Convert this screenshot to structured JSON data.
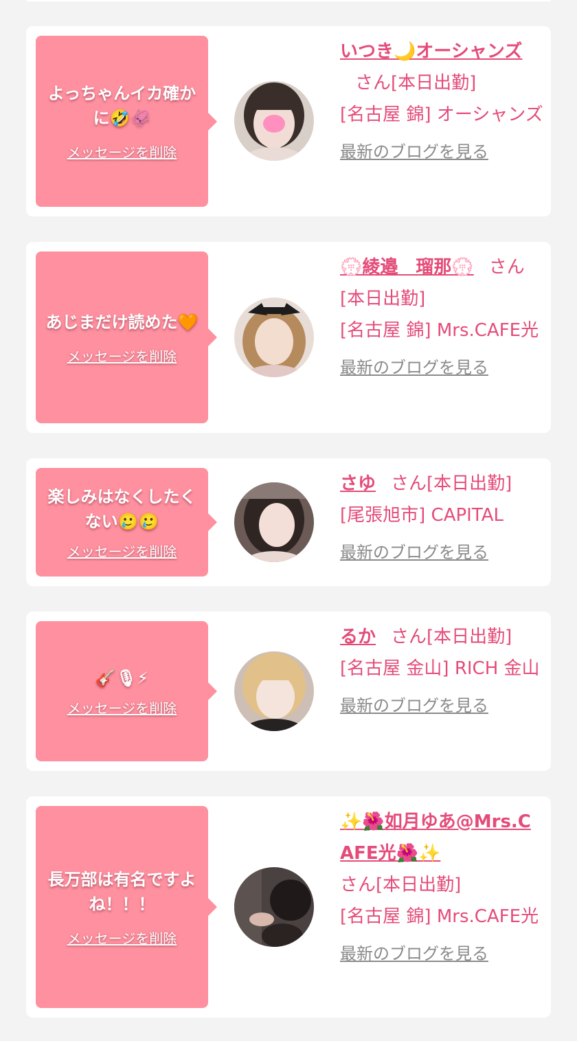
{
  "cards": [
    {
      "message": "よっちゃんイカ確かに🤣🦑",
      "delete_label": "メッセージを削除",
      "name": "いつき🌙オーシャンズ",
      "san_label": "さん[本日出勤]",
      "shop": "[名古屋 錦] オーシャンズ",
      "blog_label": "最新のブログを見る"
    },
    {
      "message": "あじまだけ読めた🧡",
      "delete_label": "メッセージを削除",
      "name": "💮綾邉　瑠那💮",
      "san_label": "さん[本日出勤]",
      "shop": "[名古屋 錦] Mrs.CAFE光",
      "blog_label": "最新のブログを見る"
    },
    {
      "message": "楽しみはなくしたくない🥲🥲",
      "delete_label": "メッセージを削除",
      "name": "さゆ",
      "san_label": "さん[本日出勤]",
      "shop": "[尾張旭市] CAPITAL",
      "blog_label": "最新のブログを見る"
    },
    {
      "message": "🎸🎙⚡",
      "delete_label": "メッセージを削除",
      "name": "るか",
      "san_label": "さん[本日出勤]",
      "shop": "[名古屋 金山] RICH 金山",
      "blog_label": "最新のブログを見る"
    },
    {
      "message": "長万部は有名ですよね！！！",
      "delete_label": "メッセージを削除",
      "name": "✨🌺如月ゆあ@Mrs.CAFE光🌺✨",
      "san_label": "さん[本日出勤]",
      "shop": "[名古屋 錦] Mrs.CAFE光",
      "blog_label": "最新のブログを見る"
    }
  ],
  "colors": {
    "bubble": "#fe909f",
    "accent": "#e44b78",
    "blog_link": "#8a8a8a",
    "background": "#f3f3f3"
  }
}
